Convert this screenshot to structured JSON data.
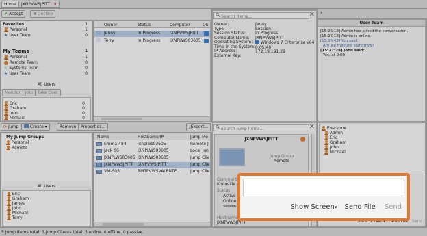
{
  "tabs": {
    "home": "Home",
    "session": "JXNPVWSJPITT",
    "close": "×"
  },
  "toolbar": {
    "accept": "Accept",
    "decline": "Decline"
  },
  "teams_panel": {
    "favorites": {
      "title": "Favorites",
      "count": "1",
      "items": [
        {
          "label": "Personal",
          "count": "1"
        },
        {
          "label": "User Team",
          "count": "0"
        }
      ]
    },
    "my_teams": {
      "title": "My Teams",
      "count": "1",
      "items": [
        {
          "label": "Personal",
          "count": "1"
        },
        {
          "label": "Remote Team",
          "count": "0"
        },
        {
          "label": "Systems Team",
          "count": "0"
        },
        {
          "label": "User Team",
          "count": "0"
        }
      ]
    },
    "all_users": "All Users",
    "buttons": {
      "monitor": "Monitor",
      "join": "Join",
      "take_over": "Take Over"
    },
    "users": [
      {
        "name": "Eric",
        "count": "0"
      },
      {
        "name": "Graham",
        "count": "0"
      },
      {
        "name": "John",
        "count": "0"
      },
      {
        "name": "Michael",
        "count": "0"
      }
    ]
  },
  "sessions_table": {
    "headers": [
      "Owner",
      "Status",
      "Computer",
      "OS"
    ],
    "rows": [
      {
        "owner": "Jenny",
        "status": "In Progress",
        "computer": "JXNPVWSJPITT"
      },
      {
        "owner": "Terry",
        "status": "In Progress",
        "computer": "JXNPLWS03605"
      }
    ]
  },
  "search": {
    "placeholder": "Search Items..."
  },
  "details": {
    "labels": [
      "Owner:",
      "Type:",
      "Session Status:",
      "Computer Name:",
      "Operating System:",
      "Time in the System:",
      "IP Address:",
      "External Key:"
    ],
    "values": [
      "Jenny",
      "Session",
      "In Progress",
      "JXNPVWSJPITT",
      "Windows 7 Enterprise x64",
      "0:05:40",
      "172.19.191.29",
      ""
    ]
  },
  "chat": {
    "title": "User Team",
    "messages": [
      {
        "text": "[15:26:18] Admin has joined the conversation."
      },
      {
        "text": "[15:26:18] Admin is online."
      },
      {
        "text": "[15:26:43] You said:"
      },
      {
        "text": "Are we meeting tomorrow?"
      },
      {
        "text": "[15:27:28] John said:"
      },
      {
        "text": "Yes, at 9:00"
      }
    ],
    "show_screen": "Show Screen",
    "send_file": "Send File",
    "send": "Send"
  },
  "bottom_toolbar": {
    "jump": "Jump",
    "create": "Create",
    "remove": "Remove",
    "properties": "Properties...",
    "export": "Export..."
  },
  "jump_groups": {
    "title": "My Jump Groups",
    "items": [
      "Personal",
      "Remote"
    ],
    "all_users": "All Users",
    "users": [
      "Eric",
      "Graham",
      "James",
      "John",
      "Michael",
      "Terry"
    ]
  },
  "jump_table": {
    "headers": [
      "Name",
      "Hostname/IP",
      "Jump Me"
    ],
    "rows": [
      {
        "name": "Emma 484",
        "host": "jxnplws03605",
        "method": "Remote J"
      },
      {
        "name": "Jack 06",
        "host": "JXNPLWS03605",
        "method": "Local Jun"
      },
      {
        "name": "JXNPLWS03605",
        "host": "JXNPLWS03605",
        "method": "Jump Clie"
      },
      {
        "name": "JXNPVWSJPITT",
        "host": "JXNPVWSJPITT",
        "method": "Jump Clie"
      },
      {
        "name": "VM-S05",
        "host": "RMTPVWSVALENTE",
        "method": "Jump Clie"
      }
    ]
  },
  "jump_search": {
    "placeholder": "Search Jump Items..."
  },
  "jump_detail": {
    "title": "JXNPVWSJPITT",
    "group_label": "Jump Group",
    "group_value": "Remote",
    "comments": "Comments",
    "comments_value": "Knoxville Office",
    "status": "Status",
    "status_lines": [
      "Active |",
      "Online |",
      "Session started at 09/19/2017 08:28:09 PM"
    ],
    "hostname_label": "Hostname / IP",
    "hostname_value": "JXNPVWSJPITT"
  },
  "chat_users": [
    "Everyone",
    "Admin",
    "Eric",
    "Graham",
    "John",
    "Michael"
  ],
  "chat_bottom": {
    "show_screen": "Show Screen",
    "send_file": "Send File",
    "send": "Send"
  },
  "status_bar": "5 Jump Items total. 3 Jump Clients total. 3 online. 0 offline. 0 passive.",
  "colors": {
    "highlight": "#e8772e",
    "accent_blue": "#2f6fb6",
    "dim": "#8f8f8f"
  }
}
